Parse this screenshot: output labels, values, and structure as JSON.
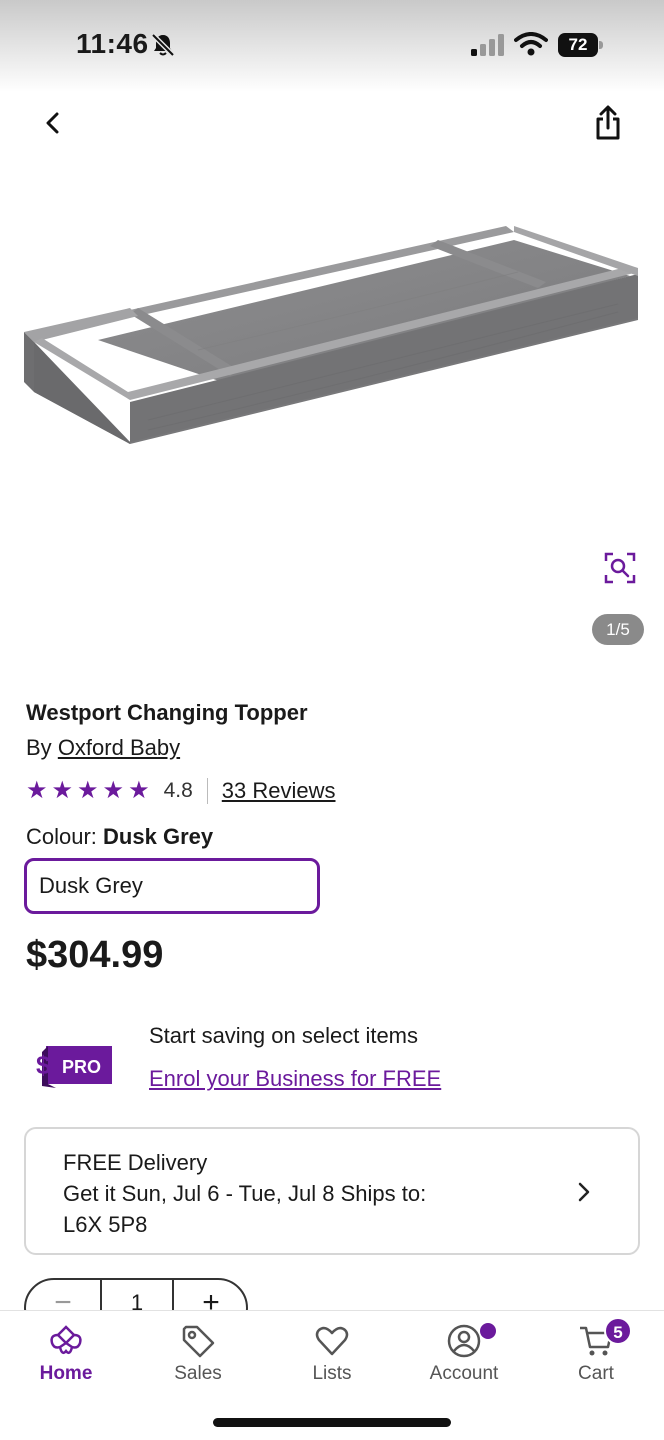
{
  "status_bar": {
    "time": "11:46",
    "battery": "72",
    "icons": [
      "bell-slash-icon",
      "signal-icon",
      "wifi-icon",
      "battery-icon"
    ]
  },
  "nav": {
    "back_icon": "chevron-left-icon",
    "share_icon": "share-icon"
  },
  "gallery": {
    "counter": "1/5",
    "zoom_icon": "zoom-icon"
  },
  "product": {
    "title": "Westport Changing Topper",
    "brand_prefix": "By",
    "brand": "Oxford Baby",
    "rating": "4.8",
    "rating_stars": 5,
    "reviews": "33 Reviews",
    "colour_label": "Colour:",
    "colour_value": "Dusk Grey",
    "colour_option": "Dusk Grey",
    "price": "$304.99"
  },
  "pro": {
    "badge_dollar": "$",
    "badge_text": "PRO",
    "text": "Start saving on select items",
    "link": "Enrol your Business for FREE"
  },
  "delivery": {
    "title": "FREE Delivery",
    "line2": "Get it Sun, Jul 6 - Tue, Jul 8 Ships to:",
    "line3": "L6X 5P8"
  },
  "quantity": {
    "minus": "−",
    "value": "1",
    "plus": "+"
  },
  "tabs": {
    "home": "Home",
    "sales": "Sales",
    "lists": "Lists",
    "account": "Account",
    "cart": "Cart",
    "cart_count": "5"
  },
  "colors": {
    "accent": "#6b1a9c",
    "text": "#1a1a1a",
    "border": "#d6d6d6"
  }
}
